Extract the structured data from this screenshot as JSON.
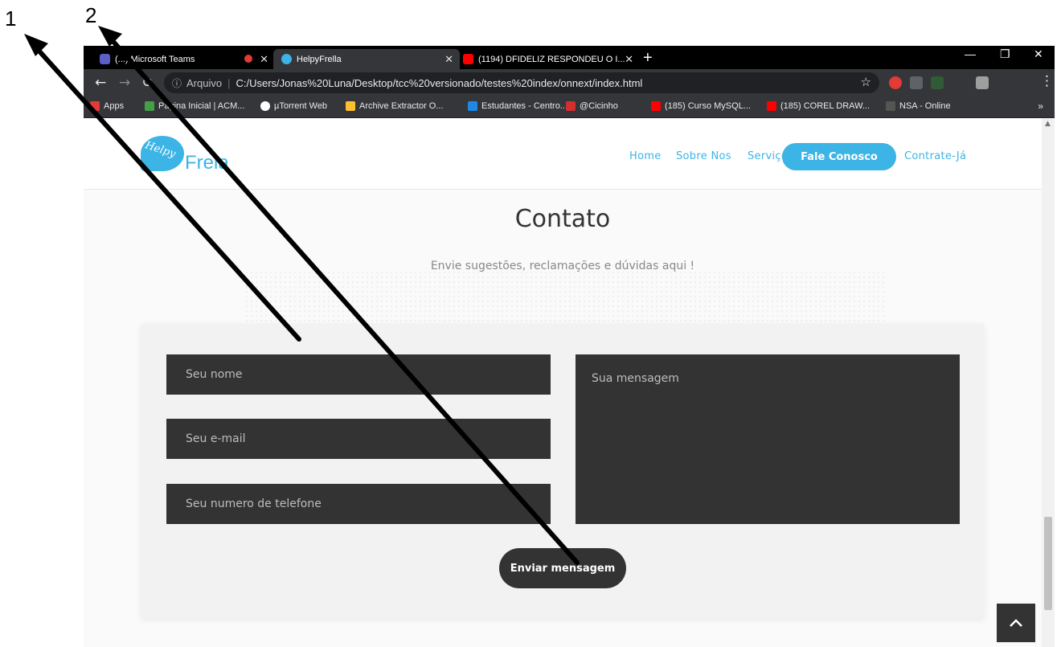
{
  "annotations": {
    "label1": "1",
    "label2": "2"
  },
  "browser": {
    "tabs": [
      {
        "title": "(...) Microsoft Teams"
      },
      {
        "title": "HelpyFrella"
      },
      {
        "title": "(1194) DFIDELIZ RESPONDEU O I..."
      }
    ],
    "new_tab": "+",
    "address": {
      "scheme_label": "Arquivo",
      "url": "C:/Users/Jonas%20Luna/Desktop/tcc%20versionado/testes%20index/onnext/index.html"
    },
    "bookmarks": [
      "Apps",
      "Página Inicial | ACM...",
      "µTorrent Web",
      "Archive Extractor O...",
      "Estudantes - Centro...",
      "@Cicinho",
      "(185) Curso MySQL...",
      "(185) COREL DRAW...",
      "NSA - Online"
    ],
    "bookmarks_more": "»"
  },
  "site": {
    "logo": {
      "script": "Helpy",
      "word": "Frela",
      "color": "#3cb4e5"
    },
    "nav": [
      "Home",
      "Sobre Nos",
      "Serviços",
      "Fale Conosco",
      "Contrate-Já"
    ],
    "nav_active": "Fale Conosco",
    "accent": "#3cb4e5"
  },
  "contact": {
    "title": "Contato",
    "subtitle": "Envie sugestões, reclamações e dúvidas aqui !",
    "placeholders": {
      "name": "Seu nome",
      "email": "Seu e-mail",
      "phone": "Seu numero de telefone",
      "message": "Sua mensagem"
    },
    "submit": "Enviar mensagem"
  },
  "icons": [
    "back-arrow-icon",
    "forward-arrow-icon",
    "reload-icon",
    "info-icon",
    "star-icon",
    "back-to-top-icon"
  ]
}
